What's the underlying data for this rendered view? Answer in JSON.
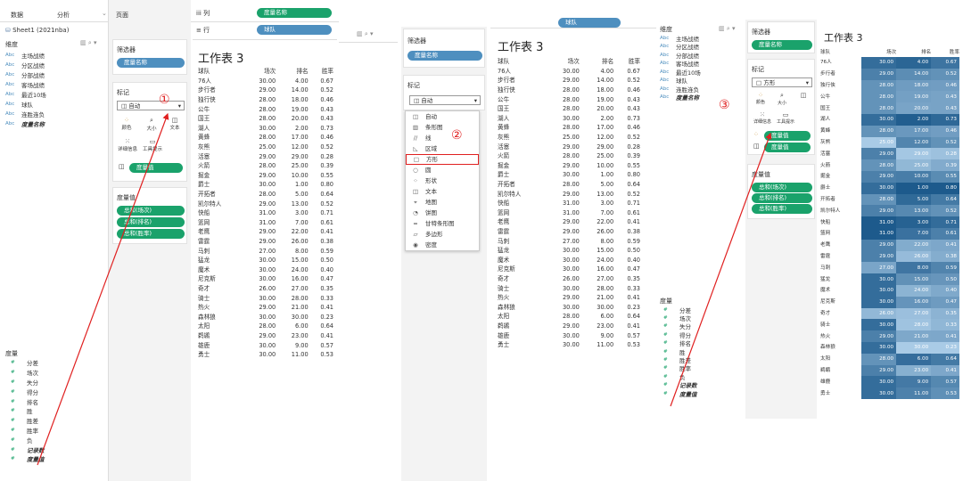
{
  "left_panel": {
    "tab_data": "数据",
    "tab_analysis": "分析",
    "tab_page": "页面",
    "datasource": "Sheet1 (2021nba)",
    "dimensions_title": "维度",
    "dimensions": [
      "主场战绩",
      "分区战绩",
      "分部战绩",
      "客场战绩",
      "最近10场",
      "球队",
      "连胜连负",
      "度量名称"
    ],
    "measures_title": "度量",
    "measures": [
      "分差",
      "场次",
      "失分",
      "得分",
      "排名",
      "胜",
      "胜差",
      "胜率",
      "负",
      "记录数",
      "度量值"
    ]
  },
  "shelves": {
    "columns_label": "列",
    "rows_label": "行",
    "columns_pill": "度量名称",
    "rows_pill": "球队"
  },
  "cards": {
    "filters_title": "筛选器",
    "filter_pill": "度量名称",
    "marks_title": "标记",
    "marks_type_auto": "自动",
    "marks_type_square": "方形",
    "color": "颜色",
    "size": "大小",
    "text": "文本",
    "detail": "详细信息",
    "tooltip": "工具提示",
    "measure_values_pill": "度量值",
    "measure_values_title": "度量值",
    "mv_items": [
      "总和(场次)",
      "总和(排名)",
      "总和(胜率)"
    ]
  },
  "dropdown": {
    "items": [
      "自动",
      "条形图",
      "线",
      "区域",
      "方形",
      "圆",
      "形状",
      "文本",
      "地图",
      "饼图",
      "甘特条形图",
      "多边形",
      "密度"
    ]
  },
  "annotations": {
    "one": "①",
    "two": "②",
    "three": "③"
  },
  "worksheet": {
    "title": "工作表 3",
    "headers": [
      "球队",
      "场次",
      "排名",
      "胜率"
    ],
    "rows": [
      [
        "76人",
        "30.00",
        "4.00",
        "0.67"
      ],
      [
        "步行者",
        "29.00",
        "14.00",
        "0.52"
      ],
      [
        "独行侠",
        "28.00",
        "18.00",
        "0.46"
      ],
      [
        "公牛",
        "28.00",
        "19.00",
        "0.43"
      ],
      [
        "国王",
        "28.00",
        "20.00",
        "0.43"
      ],
      [
        "湖人",
        "30.00",
        "2.00",
        "0.73"
      ],
      [
        "黄蜂",
        "28.00",
        "17.00",
        "0.46"
      ],
      [
        "灰熊",
        "25.00",
        "12.00",
        "0.52"
      ],
      [
        "活塞",
        "29.00",
        "29.00",
        "0.28"
      ],
      [
        "火箭",
        "28.00",
        "25.00",
        "0.39"
      ],
      [
        "掘金",
        "29.00",
        "10.00",
        "0.55"
      ],
      [
        "爵士",
        "30.00",
        "1.00",
        "0.80"
      ],
      [
        "开拓者",
        "28.00",
        "5.00",
        "0.64"
      ],
      [
        "凯尔特人",
        "29.00",
        "13.00",
        "0.52"
      ],
      [
        "快船",
        "31.00",
        "3.00",
        "0.71"
      ],
      [
        "篮网",
        "31.00",
        "7.00",
        "0.61"
      ],
      [
        "老鹰",
        "29.00",
        "22.00",
        "0.41"
      ],
      [
        "雷霆",
        "29.00",
        "26.00",
        "0.38"
      ],
      [
        "马刺",
        "27.00",
        "8.00",
        "0.59"
      ],
      [
        "猛龙",
        "30.00",
        "15.00",
        "0.50"
      ],
      [
        "魔术",
        "30.00",
        "24.00",
        "0.40"
      ],
      [
        "尼克斯",
        "30.00",
        "16.00",
        "0.47"
      ],
      [
        "奇才",
        "26.00",
        "27.00",
        "0.35"
      ],
      [
        "骑士",
        "30.00",
        "28.00",
        "0.33"
      ],
      [
        "热火",
        "29.00",
        "21.00",
        "0.41"
      ],
      [
        "森林狼",
        "30.00",
        "30.00",
        "0.23"
      ],
      [
        "太阳",
        "28.00",
        "6.00",
        "0.64"
      ],
      [
        "鹈鹕",
        "29.00",
        "23.00",
        "0.41"
      ],
      [
        "雄鹿",
        "30.00",
        "9.00",
        "0.57"
      ],
      [
        "勇士",
        "30.00",
        "11.00",
        "0.53"
      ]
    ]
  },
  "colors": {
    "pill_green": "#1aa26b",
    "pill_blue": "#4e8fbf",
    "annot_red": "#e02020",
    "heat_dark": "#1d5a8c",
    "heat_light": "#a9cbe6"
  }
}
